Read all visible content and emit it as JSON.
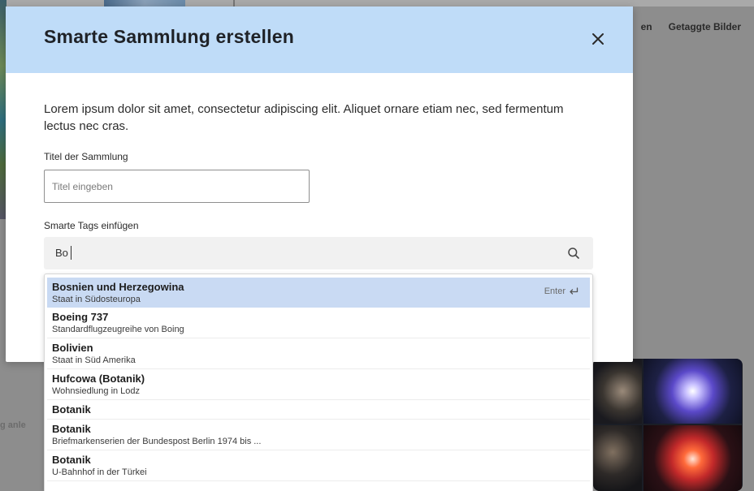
{
  "background": {
    "nav": [
      "en",
      "Getaggte Bilder"
    ],
    "side_text": "g anle"
  },
  "modal": {
    "title": "Smarte Sammlung erstellen",
    "close_icon": "close-icon",
    "description": "Lorem ipsum dolor sit amet, consectetur adipiscing elit. Aliquet ornare etiam nec, sed fermentum lectus nec cras.",
    "title_field": {
      "label": "Titel der Sammlung",
      "placeholder": "Titel eingeben",
      "value": ""
    },
    "tags_field": {
      "label": "Smarte Tags einfügen",
      "value": "Bo",
      "search_icon": "search-icon"
    },
    "suggestions": [
      {
        "title": "Bosnien und Herzegowina",
        "subtitle": "Staat in Südosteuropa",
        "hint": "Enter",
        "active": true
      },
      {
        "title": "Boeing 737",
        "subtitle": "Standardflugzeugreihe von Boing"
      },
      {
        "title": "Bolivien",
        "subtitle": "Staat in Süd Amerika"
      },
      {
        "title": "Hufcowa (Botanik)",
        "subtitle": "Wohnsiedlung in Lodz"
      },
      {
        "title": "Botanik",
        "subtitle": ""
      },
      {
        "title": "Botanik",
        "subtitle": "Briefmarkenserien der Bundespost Berlin 1974 bis ..."
      },
      {
        "title": "Botanik",
        "subtitle": "U-Bahnhof in der Türkei"
      }
    ]
  },
  "colors": {
    "header_bg": "#bfdcf8",
    "active_suggestion_bg": "#c9daf3",
    "overlay": "#8d8d8d"
  }
}
